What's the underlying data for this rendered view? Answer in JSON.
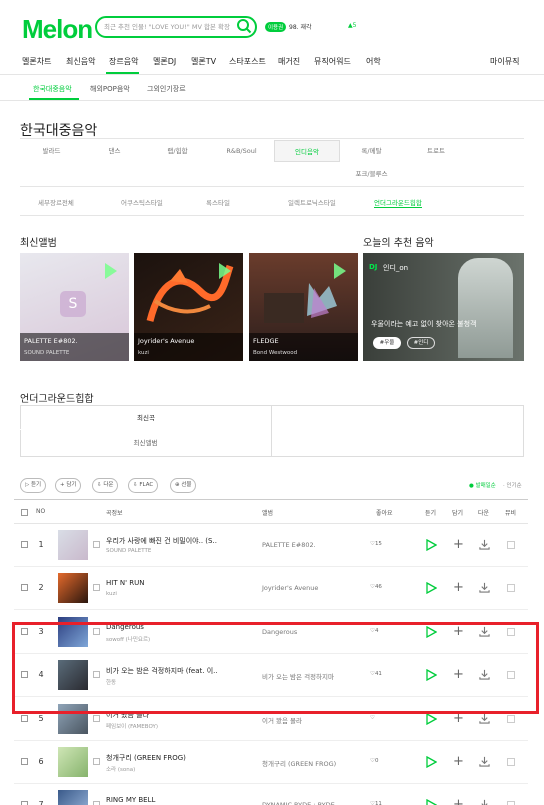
{
  "header": {
    "logo": "Melon",
    "search_placeholder": "최근 추천 인물! \"LOVE YOU!\" MV 합본 확장",
    "voucher": "이용권",
    "rank": "98. 재각",
    "rank_mark": "▲5"
  },
  "gnb": [
    "멜론차트",
    "최신음악",
    "장르음악",
    "멜론DJ",
    "멜론TV",
    "스타포스트",
    "매거진",
    "뮤직어워드",
    "어학",
    "마이뮤직"
  ],
  "subnav": [
    "한국대중음악",
    "해외POP음악",
    "그외인기장르"
  ],
  "page_title": "한국대중음악",
  "genres_row1": [
    "발라드",
    "댄스",
    "랩/힙합",
    "R&B/Soul",
    "인디음악",
    "록/메탈",
    "트로트"
  ],
  "genres_row2": [
    "포크/블루스"
  ],
  "subgenres": [
    "세부장르전체",
    "어쿠스틱스타일",
    "록스타일",
    "일렉트로닉스타일",
    "언더그라운드힙합"
  ],
  "latest_title": "최신앨범",
  "recommend_title": "오늘의 추천 음악",
  "albums": [
    {
      "title": "PALETTE E#802.",
      "artist": "SOUND PALETTE",
      "cover_top": "#e5e5ea",
      "cover_bottom": "#d8c6d8"
    },
    {
      "title": "Joyrider's Avenue",
      "artist": "kuzi",
      "cover_top": "#1b120e",
      "cover_bottom": "#2a1a12"
    },
    {
      "title": "FLEDGE",
      "artist": "Bond Westwood",
      "cover_top": "#4b2e26",
      "cover_bottom": "#2b1e1c"
    }
  ],
  "recommend": {
    "dj": "DJ",
    "name": "인디_on",
    "text": "우울이라는 예고 없이 찾아온 불청객",
    "tag1": "#우울",
    "tag2": "#인디"
  },
  "section_title": "언더그라운드힙합",
  "tabs": [
    "최신곡",
    "최신앨범"
  ],
  "actions": [
    "듣기",
    "담기",
    "다운",
    "FLAC",
    "선물"
  ],
  "sort": {
    "active": "발매일순",
    "other": "인기순"
  },
  "columns": {
    "no": "NO",
    "song": "곡정보",
    "album": "앨범",
    "like": "좋아요",
    "listen": "듣기",
    "add": "담기",
    "down": "다운",
    "mv": "뮤비"
  },
  "songs": [
    {
      "no": "1",
      "title": "우리가 사랑에 빠진 건 비밀이야.. (S..",
      "artist": "SOUND PALETTE",
      "album": "PALETTE E#802.",
      "like": "15",
      "c1": "#d9dde6",
      "c2": "#c9b9cc"
    },
    {
      "no": "2",
      "title": "HIT N' RUN",
      "artist": "kuzi",
      "album": "Joyrider's Avenue",
      "like": "46",
      "c1": "#e46a2c",
      "c2": "#2a160e"
    },
    {
      "no": "3",
      "title": "Dangerous",
      "artist": "sowoff (나민요르)",
      "album": "Dangerous",
      "like": "4",
      "c1": "#2c3e80",
      "c2": "#7fa7d8"
    },
    {
      "no": "4",
      "title": "비가 오는 밤은 걱정하지마 (feat. 이..",
      "artist": "한동",
      "album": "비가 오는 밤은 걱정하지마",
      "like": "41",
      "c1": "#5a6c7a",
      "c2": "#2a2a30"
    },
    {
      "no": "5",
      "title": "이거 봤음 몰라",
      "artist": "페임보이 (FAMEBOY)",
      "album": "이거 봤음 몰라",
      "like": "",
      "c1": "#8fa4b8",
      "c2": "#4a5560"
    },
    {
      "no": "6",
      "title": "청개구리 (GREEN FROG)",
      "artist": "소라 (sona)",
      "album": "청개구리 (GREEN FROG)",
      "like": "0",
      "c1": "#cfe6b6",
      "c2": "#86b36c"
    },
    {
      "no": "7",
      "title": "RING MY BELL",
      "artist": "",
      "album": "DYNAMIC RYDE : RYDE",
      "like": "11",
      "c1": "#3a5a8a",
      "c2": "#9fbbe0"
    }
  ]
}
